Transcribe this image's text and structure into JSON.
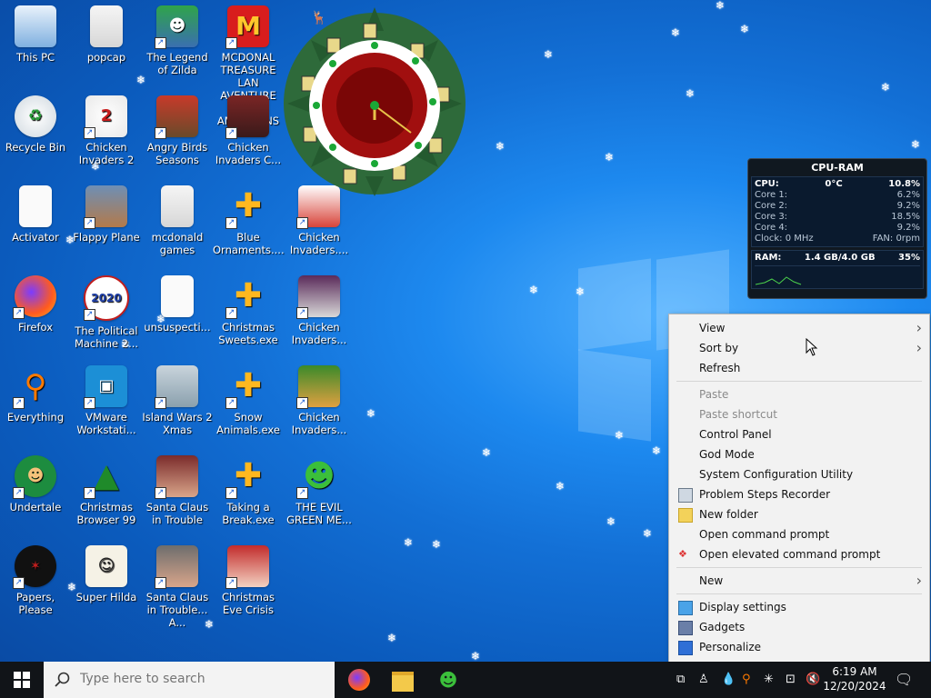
{
  "desktop": {
    "icons": [
      {
        "label": "This PC"
      },
      {
        "label": "popcap"
      },
      {
        "label": "The Legend of Zilda"
      },
      {
        "label": "MCDONAL TREASURE LAN AVENTURE FOR AMERICANS"
      },
      {
        "label": "Recycle Bin"
      },
      {
        "label": "Chicken Invaders 2"
      },
      {
        "label": "Angry Birds Seasons"
      },
      {
        "label": "Chicken Invaders C..."
      },
      {
        "label": "Activator"
      },
      {
        "label": "Flappy Plane"
      },
      {
        "label": "mcdonald games"
      },
      {
        "label": "Blue Ornaments...."
      },
      {
        "label": "Chicken Invaders...."
      },
      {
        "label": "Firefox"
      },
      {
        "label": "The Political Machine 2..."
      },
      {
        "label": "unsuspecti..."
      },
      {
        "label": "Christmas Sweets.exe"
      },
      {
        "label": "Chicken Invaders..."
      },
      {
        "label": "Everything"
      },
      {
        "label": "VMware Workstati..."
      },
      {
        "label": "Island Wars 2 Xmas"
      },
      {
        "label": "Snow Animals.exe"
      },
      {
        "label": "Chicken Invaders..."
      },
      {
        "label": "Undertale"
      },
      {
        "label": "Christmas Browser 99"
      },
      {
        "label": "Santa Claus in Trouble"
      },
      {
        "label": "Taking a Break.exe"
      },
      {
        "label": "THE EVIL GREEN ME..."
      },
      {
        "label": "Papers, Please"
      },
      {
        "label": "Super Hilda"
      },
      {
        "label": "Santa Claus in Trouble... A..."
      },
      {
        "label": "Christmas Eve Crisis"
      }
    ]
  },
  "gadget_cpu": {
    "title": "CPU-RAM",
    "cpu_label": "CPU:",
    "cpu_temp": "0°C",
    "cpu_pct": "10.8%",
    "cores": [
      {
        "name": "Core 1:",
        "pct": "6.2%"
      },
      {
        "name": "Core 2:",
        "pct": "9.2%"
      },
      {
        "name": "Core 3:",
        "pct": "18.5%"
      },
      {
        "name": "Core 4:",
        "pct": "9.2%"
      }
    ],
    "clock": "Clock: 0 MHz",
    "fan": "FAN: 0rpm",
    "ram_label": "RAM:",
    "ram_usage": "1.4 GB/4.0 GB",
    "ram_pct": "35%"
  },
  "context_menu": {
    "items": [
      {
        "label": "View"
      },
      {
        "label": "Sort by"
      },
      {
        "label": "Refresh"
      },
      {
        "label": "Paste"
      },
      {
        "label": "Paste shortcut"
      },
      {
        "label": "Control Panel"
      },
      {
        "label": "God Mode"
      },
      {
        "label": "System Configuration Utility"
      },
      {
        "label": "Problem Steps Recorder"
      },
      {
        "label": "New folder"
      },
      {
        "label": "Open command prompt"
      },
      {
        "label": "Open elevated command prompt"
      },
      {
        "label": "New"
      },
      {
        "label": "Display settings"
      },
      {
        "label": "Gadgets"
      },
      {
        "label": "Personalize"
      }
    ]
  },
  "taskbar": {
    "search_placeholder": "Type here to search",
    "time": "6:19 AM",
    "date": "12/20/2024"
  }
}
